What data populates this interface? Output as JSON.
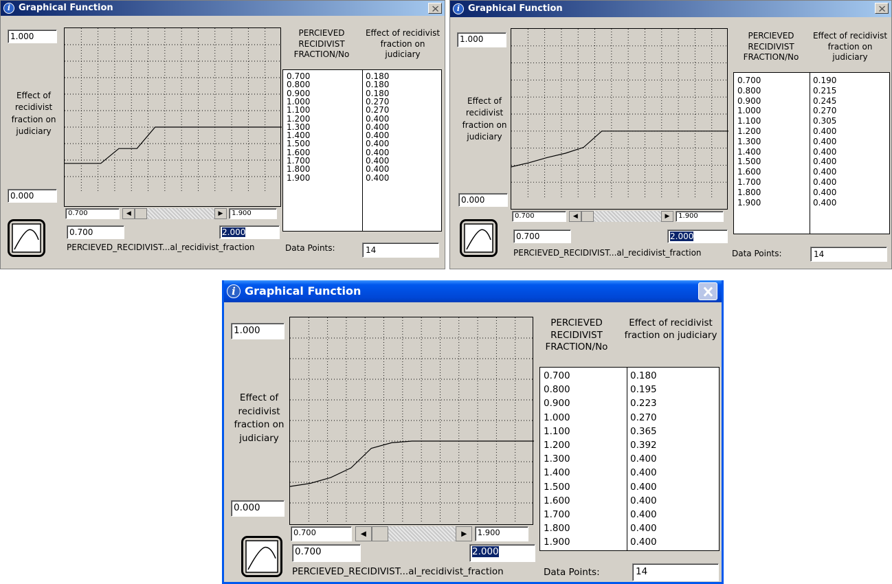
{
  "windows": [
    {
      "title": "Graphical Function",
      "y_max": "1.000",
      "y_min": "0.000",
      "y_label": "Effect of recidivist fraction on judiciary",
      "x_axis_min_label": "0.700",
      "x_axis_max_label": "1.900",
      "x_min_input": "0.700",
      "x_max_input": "2.000",
      "input_variable": "PERCIEVED_RECIDIVIST...al_recidivist_fraction",
      "col_x_header": "PERCIEVED RECIDIVIST FRACTION/No",
      "col_y_header": "Effect of recidivist fraction on judiciary",
      "data_points_label": "Data Points:",
      "data_points": "14",
      "x": [
        "0.700",
        "0.800",
        "0.900",
        "1.000",
        "1.100",
        "1.200",
        "1.300",
        "1.400",
        "1.500",
        "1.600",
        "1.700",
        "1.800",
        "1.900"
      ],
      "y": [
        "0.180",
        "0.180",
        "0.180",
        "0.270",
        "0.270",
        "0.400",
        "0.400",
        "0.400",
        "0.400",
        "0.400",
        "0.400",
        "0.400",
        "0.400"
      ]
    },
    {
      "title": "Graphical Function",
      "y_max": "1.000",
      "y_min": "0.000",
      "y_label": "Effect of recidivist fraction on judiciary",
      "x_axis_min_label": "0.700",
      "x_axis_max_label": "1.900",
      "x_min_input": "0.700",
      "x_max_input": "2.000",
      "input_variable": "PERCIEVED_RECIDIVIST...al_recidivist_fraction",
      "col_x_header": "PERCIEVED RECIDIVIST FRACTION/No",
      "col_y_header": "Effect of recidivist fraction on judiciary",
      "data_points_label": "Data Points:",
      "data_points": "14",
      "x": [
        "0.700",
        "0.800",
        "0.900",
        "1.000",
        "1.100",
        "1.200",
        "1.300",
        "1.400",
        "1.500",
        "1.600",
        "1.700",
        "1.800",
        "1.900"
      ],
      "y": [
        "0.190",
        "0.215",
        "0.245",
        "0.270",
        "0.305",
        "0.400",
        "0.400",
        "0.400",
        "0.400",
        "0.400",
        "0.400",
        "0.400",
        "0.400"
      ]
    },
    {
      "title": "Graphical Function",
      "y_max": "1.000",
      "y_min": "0.000",
      "y_label": "Effect of recidivist fraction on judiciary",
      "x_axis_min_label": "0.700",
      "x_axis_max_label": "1.900",
      "x_min_input": "0.700",
      "x_max_input": "2.000",
      "input_variable": "PERCIEVED_RECIDIVIST...al_recidivist_fraction",
      "col_x_header": "PERCIEVED RECIDIVIST FRACTION/No",
      "col_y_header": "Effect of recidivist fraction on judiciary",
      "data_points_label": "Data Points:",
      "data_points": "14",
      "x": [
        "0.700",
        "0.800",
        "0.900",
        "1.000",
        "1.100",
        "1.200",
        "1.300",
        "1.400",
        "1.500",
        "1.600",
        "1.700",
        "1.800",
        "1.900"
      ],
      "y": [
        "0.180",
        "0.195",
        "0.223",
        "0.270",
        "0.365",
        "0.392",
        "0.400",
        "0.400",
        "0.400",
        "0.400",
        "0.400",
        "0.400",
        "0.400"
      ]
    }
  ],
  "theme": {
    "classic_titlebar": "#0a246a",
    "classic_titlebar_end": "#a6caf0",
    "xp_titlebar": "#0058ee",
    "xp_titlebar_end": "#3a93ff",
    "dialog_bg": "#d4d0c8",
    "selection": "#0a246a"
  },
  "icons": [
    "info-icon",
    "close-icon",
    "graph-icon",
    "scroll-left-icon",
    "scroll-right-icon"
  ]
}
